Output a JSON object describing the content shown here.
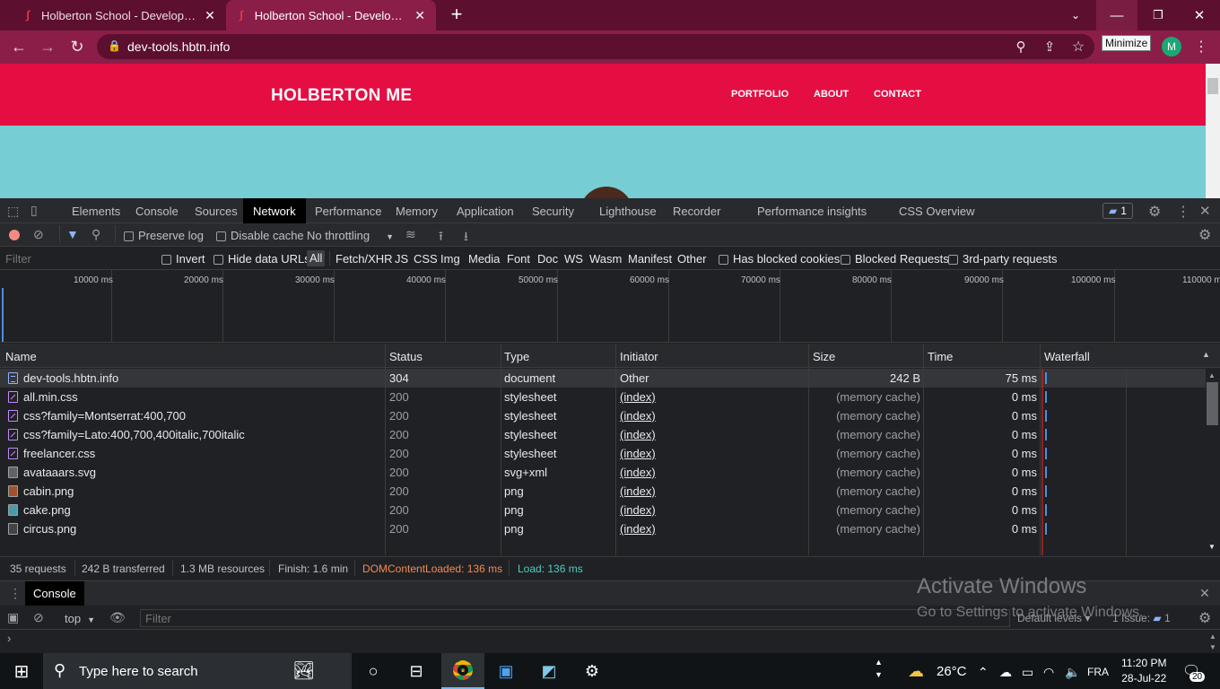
{
  "browser": {
    "tabs": [
      {
        "title": "Holberton School - Developer to"
      },
      {
        "title": "Holberton School - Developer to"
      }
    ],
    "new_tab_label": "+",
    "url": "dev-tools.hbtn.info",
    "tooltip": "Minimize",
    "avatar_letter": "M"
  },
  "page": {
    "brand": "HOLBERTON ME",
    "nav": [
      "PORTFOLIO",
      "ABOUT",
      "CONTACT"
    ]
  },
  "devtools": {
    "tabs": [
      "Elements",
      "Console",
      "Sources",
      "Network",
      "Performance",
      "Memory",
      "Application",
      "Security",
      "Lighthouse",
      "Recorder",
      "Performance insights",
      "CSS Overview"
    ],
    "active_tab": "Network",
    "issues_badge": "1",
    "toolbar": {
      "preserve_log": "Preserve log",
      "disable_cache": "Disable cache",
      "throttling": "No throttling"
    },
    "filter": {
      "placeholder": "Filter",
      "invert": "Invert",
      "hide_data_urls": "Hide data URLs",
      "types": [
        "All",
        "Fetch/XHR",
        "JS",
        "CSS",
        "Img",
        "Media",
        "Font",
        "Doc",
        "WS",
        "Wasm",
        "Manifest",
        "Other"
      ],
      "has_blocked_cookies": "Has blocked cookies",
      "blocked_requests": "Blocked Requests",
      "third_party": "3rd-party requests"
    },
    "overview_ticks": [
      "10000 ms",
      "20000 ms",
      "30000 ms",
      "40000 ms",
      "50000 ms",
      "60000 ms",
      "70000 ms",
      "80000 ms",
      "90000 ms",
      "100000 ms",
      "110000 m"
    ],
    "columns": [
      "Name",
      "Status",
      "Type",
      "Initiator",
      "Size",
      "Time",
      "Waterfall"
    ],
    "rows": [
      {
        "name": "dev-tools.hbtn.info",
        "status": "304",
        "type": "document",
        "initiator": "Other",
        "size": "242 B",
        "time": "75 ms",
        "icon": "doc"
      },
      {
        "name": "all.min.css",
        "status": "200",
        "type": "stylesheet",
        "initiator": "(index)",
        "size": "(memory cache)",
        "time": "0 ms",
        "icon": "css"
      },
      {
        "name": "css?family=Montserrat:400,700",
        "status": "200",
        "type": "stylesheet",
        "initiator": "(index)",
        "size": "(memory cache)",
        "time": "0 ms",
        "icon": "css"
      },
      {
        "name": "css?family=Lato:400,700,400italic,700italic",
        "status": "200",
        "type": "stylesheet",
        "initiator": "(index)",
        "size": "(memory cache)",
        "time": "0 ms",
        "icon": "css"
      },
      {
        "name": "freelancer.css",
        "status": "200",
        "type": "stylesheet",
        "initiator": "(index)",
        "size": "(memory cache)",
        "time": "0 ms",
        "icon": "css"
      },
      {
        "name": "avataaars.svg",
        "status": "200",
        "type": "svg+xml",
        "initiator": "(index)",
        "size": "(memory cache)",
        "time": "0 ms",
        "icon": "img"
      },
      {
        "name": "cabin.png",
        "status": "200",
        "type": "png",
        "initiator": "(index)",
        "size": "(memory cache)",
        "time": "0 ms",
        "icon": "img"
      },
      {
        "name": "cake.png",
        "status": "200",
        "type": "png",
        "initiator": "(index)",
        "size": "(memory cache)",
        "time": "0 ms",
        "icon": "img"
      },
      {
        "name": "circus.png",
        "status": "200",
        "type": "png",
        "initiator": "(index)",
        "size": "(memory cache)",
        "time": "0 ms",
        "icon": "img"
      }
    ],
    "summary": {
      "requests": "35 requests",
      "transferred": "242 B transferred",
      "resources": "1.3 MB resources",
      "finish": "Finish: 1.6 min",
      "dom": "DOMContentLoaded: 136 ms",
      "load": "Load: 136 ms"
    },
    "drawer": {
      "tab": "Console",
      "context": "top",
      "filter_placeholder": "Filter",
      "levels": "Default levels",
      "issues": "1 Issue:",
      "issues_count": "1"
    }
  },
  "watermark": {
    "line1": "Activate Windows",
    "line2": "Go to Settings to activate Windows."
  },
  "taskbar": {
    "search_placeholder": "Type here to search",
    "weather": "26°C",
    "lang": "FRA",
    "time": "11:20 PM",
    "date": "28-Jul-22",
    "notifications": "20"
  },
  "colors": {
    "brand_red": "#e40e43",
    "page_bg": "#76cdd4",
    "chrome_frame": "#5c0f2f",
    "dom_color": "#f28b54",
    "load_color": "#4ecdc4"
  }
}
